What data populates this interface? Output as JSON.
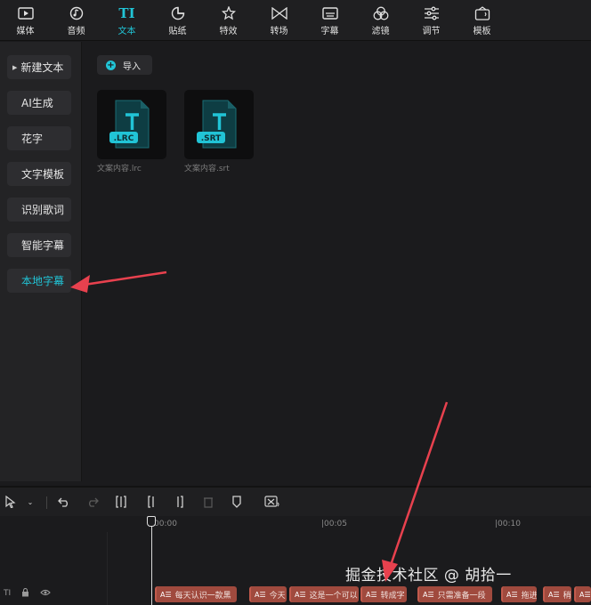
{
  "toolbar": {
    "items": [
      {
        "label": "媒体",
        "icon": "media-icon"
      },
      {
        "label": "音频",
        "icon": "audio-icon"
      },
      {
        "label": "文本",
        "icon": "text-icon",
        "glyph": "TI",
        "active": true
      },
      {
        "label": "贴纸",
        "icon": "sticker-icon"
      },
      {
        "label": "特效",
        "icon": "effects-icon"
      },
      {
        "label": "转场",
        "icon": "transition-icon"
      },
      {
        "label": "字幕",
        "icon": "subtitle-icon"
      },
      {
        "label": "滤镜",
        "icon": "filter-icon"
      },
      {
        "label": "调节",
        "icon": "adjust-icon"
      },
      {
        "label": "模板",
        "icon": "template-icon"
      }
    ]
  },
  "sidebar": {
    "items": [
      {
        "label": "新建文本"
      },
      {
        "label": "AI生成"
      },
      {
        "label": "花字"
      },
      {
        "label": "文字模板"
      },
      {
        "label": "识别歌词"
      },
      {
        "label": "智能字幕"
      },
      {
        "label": "本地字幕",
        "active": true
      }
    ]
  },
  "main": {
    "import_label": "导入",
    "files": [
      {
        "badge": ".LRC",
        "name": "文案内容.lrc"
      },
      {
        "badge": ".SRT",
        "name": "文案内容.srt"
      }
    ]
  },
  "timeline": {
    "ticks": [
      "00:00",
      "|00:05",
      "|00:10"
    ],
    "track_label": "TI",
    "clips": [
      {
        "text": "每天认识一款黑"
      },
      {
        "text": "今天"
      },
      {
        "text": "这是一个可以"
      },
      {
        "text": "转成字"
      },
      {
        "text": "只需准备一段"
      },
      {
        "text": "拖进"
      },
      {
        "text": "稍"
      },
      {
        "text": ""
      }
    ],
    "clip_icon": "A☰"
  },
  "watermark": "掘金技术社区 @ 胡拾一",
  "colors": {
    "accent": "#21c4d6",
    "clip": "#a04a3e",
    "arrow": "#e8414e"
  }
}
